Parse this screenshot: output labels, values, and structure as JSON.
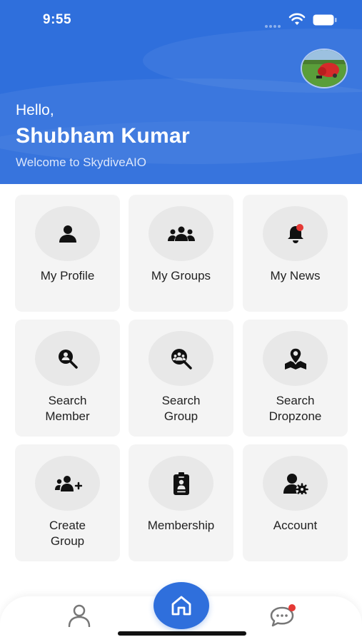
{
  "status_bar": {
    "time": "9:55"
  },
  "header": {
    "greeting": "Hello,",
    "user_name": "Shubham Kumar",
    "welcome": "Welcome to SkydiveAIO"
  },
  "menu": [
    {
      "label": "My Profile",
      "icon": "user-icon"
    },
    {
      "label": "My Groups",
      "icon": "group-icon"
    },
    {
      "label": "My News",
      "icon": "bell-icon",
      "badge": true
    },
    {
      "label_lines": [
        "Search",
        "Member"
      ],
      "icon": "search-member-icon"
    },
    {
      "label_lines": [
        "Search",
        "Group"
      ],
      "icon": "search-group-icon"
    },
    {
      "label_lines": [
        "Search",
        "Dropzone"
      ],
      "icon": "map-pin-icon"
    },
    {
      "label_lines": [
        "Create",
        "Group"
      ],
      "icon": "add-group-icon"
    },
    {
      "label": "Membership",
      "icon": "id-badge-icon"
    },
    {
      "label": "Account",
      "icon": "user-settings-icon"
    }
  ],
  "bottom_nav": {
    "items": [
      "profile-icon",
      "home-icon",
      "chat-icon"
    ],
    "active": "home-icon"
  },
  "colors": {
    "primary": "#2f6fdc",
    "card": "#f4f4f4",
    "badge": "#e53935"
  }
}
